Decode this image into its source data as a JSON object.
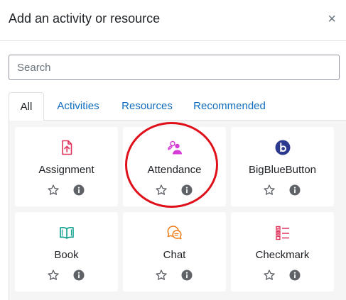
{
  "dialog": {
    "title": "Add an activity or resource",
    "close_glyph": "×"
  },
  "search": {
    "placeholder": "Search",
    "value": ""
  },
  "tabs": [
    {
      "label": "All",
      "active": true
    },
    {
      "label": "Activities",
      "active": false
    },
    {
      "label": "Resources",
      "active": false
    },
    {
      "label": "Recommended",
      "active": false
    }
  ],
  "modules": [
    {
      "label": "Assignment",
      "icon": "assignment-upload-icon",
      "color": "#e0345c"
    },
    {
      "label": "Attendance",
      "icon": "attendance-people-icon",
      "color": "#d63cd6"
    },
    {
      "label": "BigBlueButton",
      "icon": "bigbluebutton-icon",
      "color": "#2b3a8f"
    },
    {
      "label": "Book",
      "icon": "book-icon",
      "color": "#0b9e8c"
    },
    {
      "label": "Chat",
      "icon": "chat-bubbles-icon",
      "color": "#f07c1a"
    },
    {
      "label": "Checkmark",
      "icon": "checklist-icon",
      "color": "#e0345c"
    }
  ],
  "highlight": {
    "target": "Attendance",
    "color": "#e0101a"
  },
  "colors": {
    "link": "#0f6cbf",
    "icon_action": "#5f6368",
    "panel_bg": "#f5f5f5"
  }
}
